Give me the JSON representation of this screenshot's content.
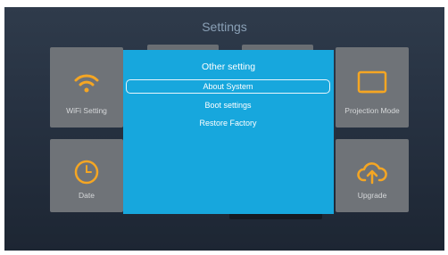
{
  "screen": {
    "title": "Settings"
  },
  "tiles": {
    "wifi": {
      "label": "WiFi Setting",
      "icon": "wifi-icon"
    },
    "date": {
      "label": "Date",
      "icon": "clock-icon"
    },
    "projection": {
      "label": "Projection Mode",
      "icon": "monitor-icon"
    },
    "upgrade": {
      "label": "Upgrade",
      "icon": "cloud-upload-icon"
    }
  },
  "dialog": {
    "title": "Other setting",
    "items": [
      {
        "label": "About System",
        "selected": true
      },
      {
        "label": "Boot settings",
        "selected": false
      },
      {
        "label": "Restore Factory",
        "selected": false
      }
    ]
  },
  "colors": {
    "accent": "#f5a623",
    "dialog_bg": "#17a7dd",
    "tile_bg": "#6f7378",
    "screen_bg": "#273242"
  }
}
